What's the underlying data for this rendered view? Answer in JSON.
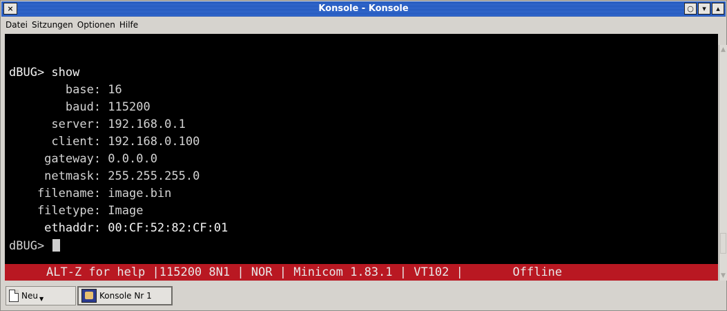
{
  "window": {
    "title": "Konsole - Konsole",
    "close_glyph": "×",
    "buttons": [
      "○",
      "▾",
      "▴"
    ]
  },
  "menubar": {
    "items": [
      "Datei",
      "Sitzungen",
      "Optionen",
      "Hilfe"
    ]
  },
  "terminal": {
    "lines": [
      "dBUG> show",
      "        base: 16",
      "        baud: 115200",
      "      server: 192.168.0.1",
      "      client: 192.168.0.100",
      "     gateway: 0.0.0.0",
      "     netmask: 255.255.255.0",
      "    filename: image.bin",
      "    filetype: Image",
      "     ethaddr: 00:CF:52:82:CF:01",
      "dBUG> "
    ],
    "status": "ALT-Z for help |115200 8N1 | NOR | Minicom 1.83.1 | VT102 |       Offline"
  },
  "tabs": {
    "new_label": "Neu",
    "session_label": "Konsole Nr 1"
  },
  "colors": {
    "terminal_bg": "#000000",
    "status_bg": "#b91822",
    "titlebar": "#2a5fc4"
  }
}
